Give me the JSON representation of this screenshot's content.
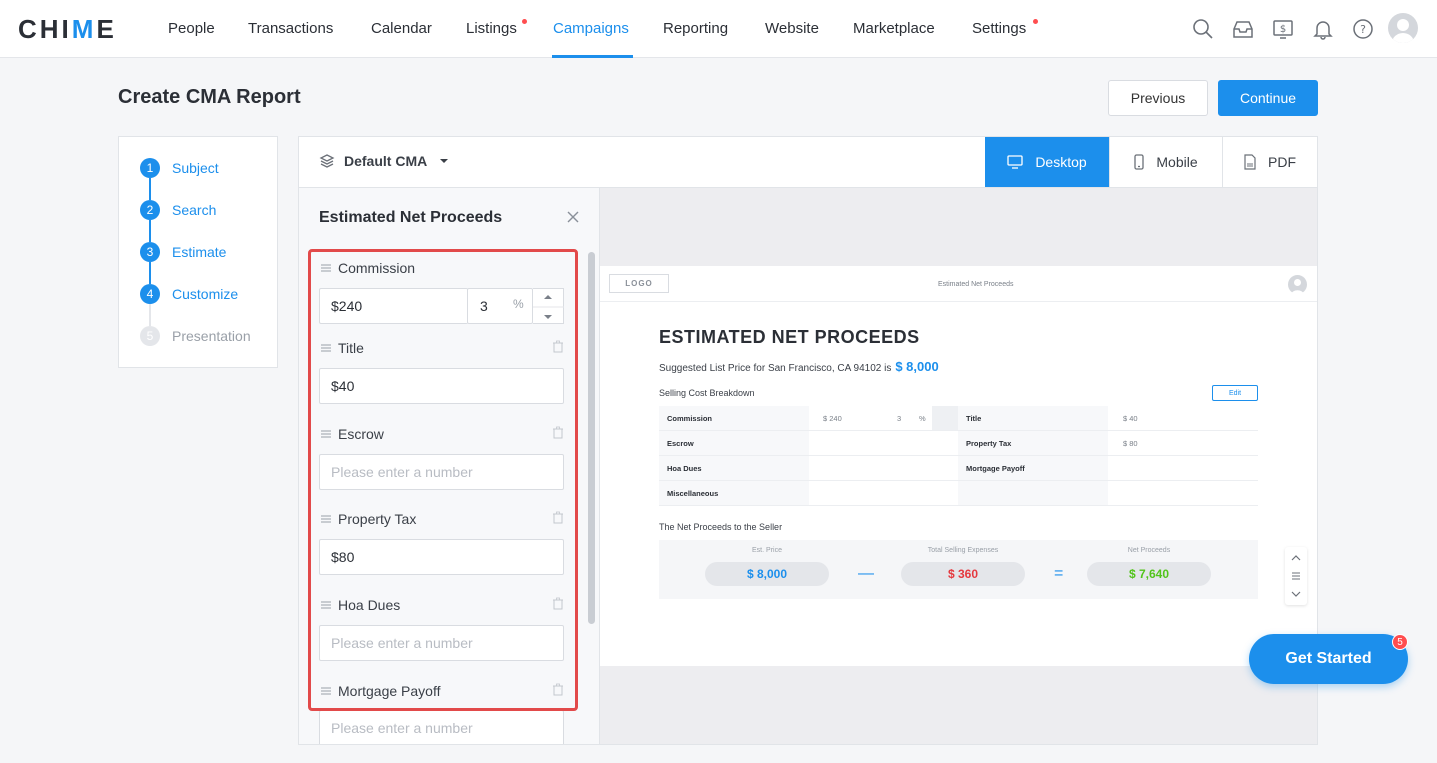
{
  "brand": {
    "logo_pre": "CHI",
    "logo_v": "M",
    "logo_post": "E",
    "accent": "#1c8fec"
  },
  "nav": {
    "items": [
      {
        "label": "People"
      },
      {
        "label": "Transactions"
      },
      {
        "label": "Calendar"
      },
      {
        "label": "Listings"
      },
      {
        "label": "Campaigns"
      },
      {
        "label": "Reporting"
      },
      {
        "label": "Website"
      },
      {
        "label": "Marketplace"
      },
      {
        "label": "Settings"
      }
    ],
    "active": "Campaigns",
    "icons": [
      "search-icon",
      "inbox-icon",
      "dollar-icon",
      "bell-icon",
      "help-icon"
    ]
  },
  "page": {
    "title": "Create CMA Report",
    "previous_label": "Previous",
    "continue_label": "Continue"
  },
  "steps": [
    {
      "num": "1",
      "label": "Subject"
    },
    {
      "num": "2",
      "label": "Search"
    },
    {
      "num": "3",
      "label": "Estimate"
    },
    {
      "num": "4",
      "label": "Customize"
    },
    {
      "num": "5",
      "label": "Presentation"
    }
  ],
  "toolbar": {
    "template": "Default CMA",
    "views": [
      {
        "label": "Desktop"
      },
      {
        "label": "Mobile"
      },
      {
        "label": "PDF"
      }
    ],
    "active_view": "Desktop"
  },
  "editor": {
    "title": "Estimated Net Proceeds",
    "placeholder": "Please enter a number",
    "commission": {
      "label": "Commission",
      "amount": "$240",
      "percent": "3",
      "percent_unit": "%"
    },
    "fields": [
      {
        "label": "Title",
        "value": "$40"
      },
      {
        "label": "Escrow",
        "value": ""
      },
      {
        "label": "Property Tax",
        "value": "$80"
      },
      {
        "label": "Hoa Dues",
        "value": ""
      },
      {
        "label": "Mortgage Payoff",
        "value": ""
      }
    ]
  },
  "preview": {
    "logo": "LOGO",
    "header": "Estimated Net Proceeds",
    "heading": "ESTIMATED NET PROCEEDS",
    "subtitle": "Suggested List Price for San Francisco, CA 94102 is",
    "list_price": "$ 8,000",
    "breakdown_label": "Selling Cost Breakdown",
    "edit_label": "Edit",
    "rows": [
      {
        "l1": "Commission",
        "v1": "$ 240",
        "pct": "3",
        "unit": "%",
        "l2": "Title",
        "v2": "$ 40"
      },
      {
        "l1": "Escrow",
        "v1": "",
        "pct": "",
        "unit": "",
        "l2": "Property Tax",
        "v2": "$ 80"
      },
      {
        "l1": "Hoa Dues",
        "v1": "",
        "pct": "",
        "unit": "",
        "l2": "Mortgage Payoff",
        "v2": ""
      },
      {
        "l1": "Miscellaneous",
        "v1": "",
        "pct": "",
        "unit": "",
        "l2": "",
        "v2": ""
      }
    ],
    "net_label": "The Net Proceeds to the Seller",
    "summary": {
      "est_price_label": "Est. Price",
      "est_price": "$ 8,000",
      "expenses_label": "Total Selling Expenses",
      "expenses": "$ 360",
      "net_label": "Net Proceeds",
      "net": "$ 7,640",
      "minus": "—",
      "equals": "="
    },
    "colors": {
      "price": "#1c8fec",
      "expenses": "#e5393f",
      "net": "#52c41a"
    }
  },
  "floating": {
    "cta": "Get Started",
    "badge": "5"
  }
}
